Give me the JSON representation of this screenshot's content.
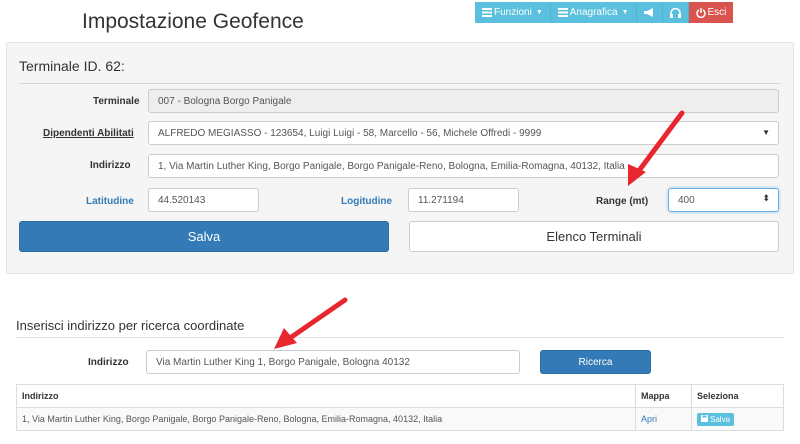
{
  "page": {
    "title": "Impostazione Geofence"
  },
  "nav": {
    "items": [
      {
        "label": "Funzioni",
        "icon": "list-icon",
        "dropdown": true
      },
      {
        "label": "Anagrafica",
        "icon": "list-icon",
        "dropdown": true
      },
      {
        "label": "",
        "icon": "megaphone-icon"
      },
      {
        "label": "",
        "icon": "headset-icon"
      },
      {
        "label": "Esci",
        "icon": "power-icon",
        "color": "#d9534f"
      }
    ]
  },
  "terminal": {
    "title": "Terminale ID. 62:",
    "terminale_label": "Terminale",
    "terminale_value": "007 - Bologna Borgo Panigale",
    "dipendenti_label": "Dipendenti Abilitati",
    "dipendenti_value": "ALFREDO MEGIASSO - 123654, Luigi Luigi - 58, Marcello - 56, Michele Offredi - 9999",
    "indirizzo_label": "Indirizzo",
    "indirizzo_value": "1, Via Martin Luther King, Borgo Panigale, Borgo Panigale-Reno, Bologna, Emilia-Romagna, 40132, Italia",
    "latitudine_label": "Latitudine",
    "latitudine_value": "44.520143",
    "logitudine_label": "Logitudine",
    "logitudine_value": "11.271194",
    "range_label": "Range (mt)",
    "range_value": "400",
    "save_label": "Salva",
    "list_label": "Elenco Terminali"
  },
  "search": {
    "title": "Inserisci indirizzo per ricerca coordinate",
    "indirizzo_label": "Indirizzo",
    "indirizzo_value": "Via Martin Luther King 1, Borgo Panigale, Bologna 40132",
    "button_label": "Ricerca"
  },
  "results": {
    "columns": [
      "Indirizzo",
      "Mappa",
      "Seleziona"
    ],
    "rows": [
      {
        "indirizzo": "1, Via Martin Luther King, Borgo Panigale, Borgo Panigale-Reno, Bologna, Emilia-Romagna, 40132, Italia",
        "mappa": "Apri",
        "seleziona": "Salva"
      }
    ]
  },
  "colors": {
    "primary": "#337ab7",
    "info": "#5bc0de",
    "danger": "#d9534f",
    "arrow": "#e8262e"
  }
}
